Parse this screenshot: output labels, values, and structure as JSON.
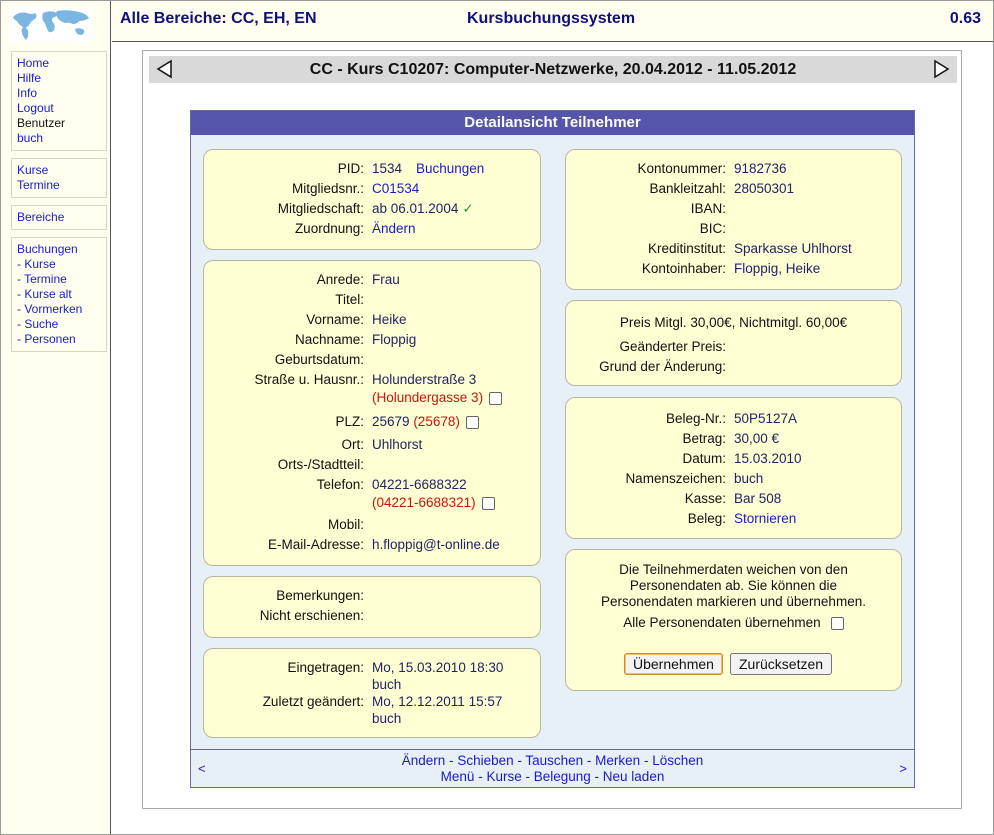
{
  "header": {
    "areas": "Alle Bereiche: CC, EH, EN",
    "system": "Kursbuchungssystem",
    "version": "0.63"
  },
  "menu": {
    "main": [
      "Home",
      "Hilfe",
      "Info",
      "Logout"
    ],
    "user_label": "Benutzer",
    "user_name": "buch",
    "courses": [
      "Kurse",
      "Termine"
    ],
    "areas": "Bereiche",
    "bookings": [
      "Buchungen",
      "- Kurse",
      "- Termine",
      "- Kurse alt",
      "- Vormerken",
      "- Suche",
      "- Personen"
    ]
  },
  "course": {
    "title": "CC - Kurs C10207: Computer-Netzwerke, 20.04.2012 - 11.05.2012"
  },
  "detail": {
    "title": "Detailansicht Teilnehmer",
    "membership": {
      "pid_label": "PID:",
      "pid": "1534",
      "bookings_link": "Buchungen",
      "member_no_label": "Mitgliedsnr.:",
      "member_no": "C01534",
      "membership_label": "Mitgliedschaft:",
      "membership": "ab 06.01.2004",
      "check": "✓",
      "assignment_label": "Zuordnung:",
      "assignment_link": "Ändern"
    },
    "person": {
      "salutation_label": "Anrede:",
      "salutation": "Frau",
      "title_label": "Titel:",
      "title": "",
      "firstname_label": "Vorname:",
      "firstname": "Heike",
      "lastname_label": "Nachname:",
      "lastname": "Floppig",
      "birthdate_label": "Geburtsdatum:",
      "birthdate": "",
      "street_label": "Straße u. Hausnr.:",
      "street": "Holunderstraße 3",
      "street_alt": "(Holundergasse 3)",
      "zip_label": "PLZ:",
      "zip": "25679",
      "zip_alt": "(25678)",
      "city_label": "Ort:",
      "city": "Uhlhorst",
      "district_label": "Orts-/Stadtteil:",
      "district": "",
      "phone_label": "Telefon:",
      "phone": "04221-6688322",
      "phone_alt": "(04221-6688321)",
      "mobile_label": "Mobil:",
      "mobile": "",
      "email_label": "E-Mail-Adresse:",
      "email": "h.floppig@t-online.de"
    },
    "remarks": {
      "remarks_label": "Bemerkungen:",
      "remarks": "",
      "absent_label": "Nicht erschienen:",
      "absent": ""
    },
    "timestamps": {
      "entered_label": "Eingetragen:",
      "entered": "Mo, 15.03.2010 18:30",
      "entered_by": "buch",
      "changed_label": "Zuletzt geändert:",
      "changed": "Mo, 12.12.2011 15:57",
      "changed_by": "buch"
    },
    "bank": {
      "account_label": "Kontonummer:",
      "account": "9182736",
      "blz_label": "Bankleitzahl:",
      "blz": "28050301",
      "iban_label": "IBAN:",
      "iban": "",
      "bic_label": "BIC:",
      "bic": "",
      "institute_label": "Kreditinstitut:",
      "institute": "Sparkasse Uhlhorst",
      "holder_label": "Kontoinhaber:",
      "holder": "Floppig, Heike"
    },
    "price": {
      "price_text": "Preis Mitgl. 30,00€, Nichtmitgl. 60,00€",
      "changed_price_label": "Geänderter Preis:",
      "changed_price": "",
      "reason_label": "Grund der Änderung:",
      "reason": ""
    },
    "receipt": {
      "no_label": "Beleg-Nr.:",
      "no": "50P5127A",
      "amount_label": "Betrag:",
      "amount": "30,00 €",
      "date_label": "Datum:",
      "date": "15.03.2010",
      "sign_label": "Namenszeichen:",
      "sign": "buch",
      "register_label": "Kasse:",
      "register": "Bar 508",
      "receipt_label": "Beleg:",
      "receipt_link": "Stornieren"
    },
    "diff": {
      "line1": "Die Teilnehmerdaten weichen von den",
      "line2": "Personendaten ab. Sie können die",
      "line3": "Personendaten markieren und übernehmen.",
      "take_all_label": "Alle Personendaten übernehmen",
      "apply_button": "Übernehmen",
      "reset_button": "Zurücksetzen"
    },
    "footer": {
      "prev": "<",
      "next": ">",
      "actions1": [
        "Ändern",
        "Schieben",
        "Tauschen",
        "Merken",
        "Löschen"
      ],
      "actions2": [
        "Menü",
        "Kurse",
        "Belegung",
        "Neu laden"
      ],
      "separator": " - "
    }
  },
  "colors": {
    "sidebar_bg": "#fffff0",
    "card_bg": "#ffffd4",
    "title_bar": "#5555aa",
    "link": "#1a1acc",
    "alt_value": "#d01010"
  }
}
